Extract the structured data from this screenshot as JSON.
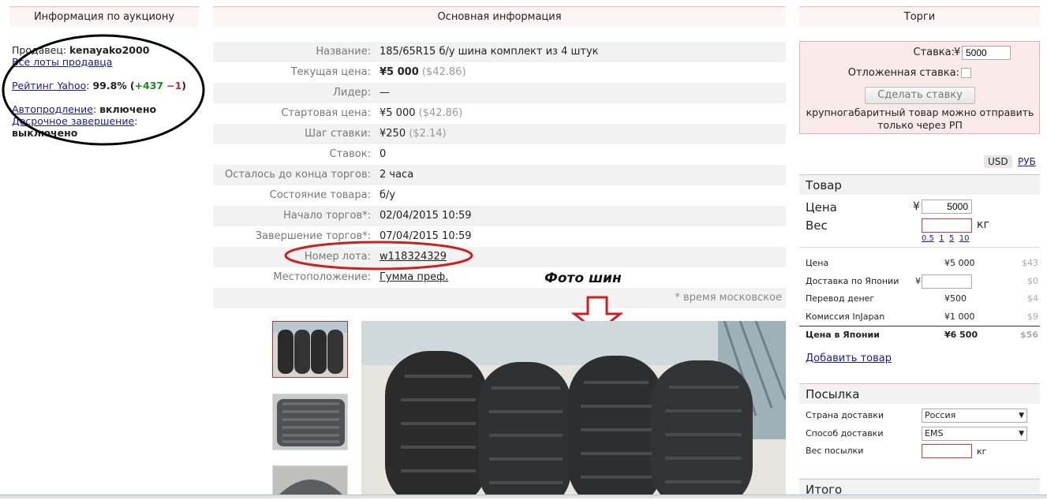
{
  "left": {
    "header": "Информация по аукциону",
    "seller_label": "Продавец:",
    "seller_name": "kenayako2000",
    "all_lots_link": "Все лоты продавца",
    "rating_link": "Рейтинг Yahoo",
    "rating_colon": ":",
    "rating_value": "99.8%",
    "rating_open": "(",
    "rating_plus": "+437",
    "rating_minus": "−1",
    "rating_close": ")",
    "auto_extend_link": "Автопродление",
    "auto_extend_colon": ":",
    "auto_extend_value": "включено",
    "early_end_link": "Досрочное завершение",
    "early_end_colon": ":",
    "early_end_value": "выключено"
  },
  "center": {
    "header": "Основная информация",
    "rows": [
      {
        "label": "Название:",
        "value": "185/65R15 б/у шина комплект из 4 штук"
      },
      {
        "label": "Текущая цена:",
        "value": "¥5 000",
        "extra": "($42.86)"
      },
      {
        "label": "Лидер:",
        "value": "—"
      },
      {
        "label": "Стартовая цена:",
        "value": "¥5 000",
        "extra": "($42.86)"
      },
      {
        "label": "Шаг ставки:",
        "value": "¥250",
        "extra": "($2.14)"
      },
      {
        "label": "Ставок:",
        "value": "0"
      },
      {
        "label": "Осталось до конца торгов:",
        "value": "2 часа"
      },
      {
        "label": "Состояние товара:",
        "value": "б/у"
      },
      {
        "label": "Начало торгов*:",
        "value": "02/04/2015 10:59"
      },
      {
        "label": "Завершение торгов*:",
        "value": "07/04/2015 10:59"
      },
      {
        "label": "Номер лота:",
        "value": "w118324329"
      },
      {
        "label": "Местоположение:",
        "value": "Гумма преф."
      }
    ],
    "note": "* время московское",
    "annotation": "Фото шин"
  },
  "right": {
    "header": "Торги",
    "bid_label": "Ставка:",
    "bid_currency": "¥",
    "bid_value": "5000",
    "delayed_label": "Отложенная ставка:",
    "bid_button": "Сделать ставку",
    "bid_note": "крупногабаритный товар можно отправить только через РП",
    "currency_usd": "USD",
    "currency_rub": "РУБ",
    "item_header": "Товар",
    "price_label": "Цена",
    "price_currency": "¥",
    "price_value": "5000",
    "weight_label": "Вес",
    "weight_unit": "кг",
    "weight_presets": [
      "0.5",
      "1",
      "5",
      "10"
    ],
    "calc_rows": [
      {
        "label": "Цена",
        "value": "¥5 000",
        "usd": "$43"
      },
      {
        "label": "Доставка по Японии",
        "value": "¥",
        "usd": "$0"
      },
      {
        "label": "Перевод денег",
        "value": "¥500",
        "usd": "$4"
      },
      {
        "label": "Комиссия InJapan",
        "value": "¥1 000",
        "usd": "$9"
      },
      {
        "label": "Цена в Японии",
        "value": "¥6 500",
        "usd": "$56"
      }
    ],
    "add_item_link": "Добавить товар",
    "parcel_header": "Посылка",
    "country_label": "Страна доставки",
    "country_value": "Россия",
    "method_label": "Способ доставки",
    "method_value": "EMS",
    "parcel_weight_label": "Вес посылки",
    "parcel_weight_unit": "кг",
    "total_header": "Итого"
  }
}
